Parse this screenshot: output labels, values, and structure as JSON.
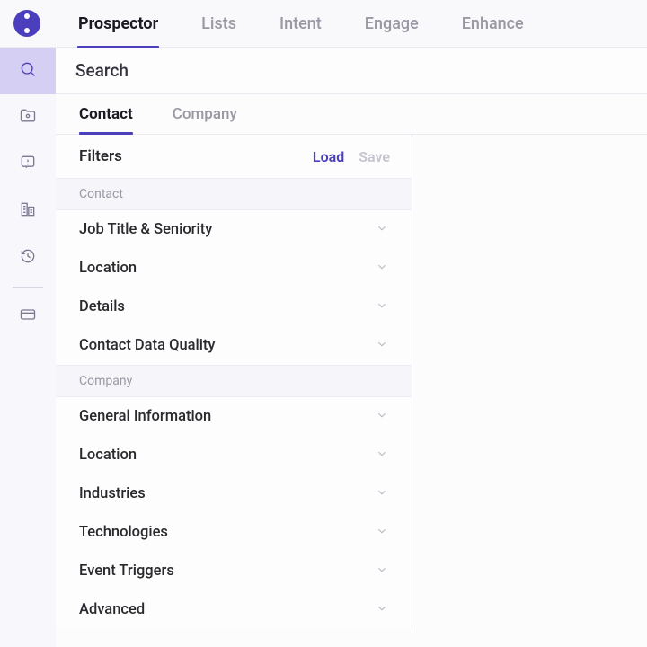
{
  "topnav": {
    "items": [
      "Prospector",
      "Lists",
      "Intent",
      "Engage",
      "Enhance"
    ],
    "activeIndex": 0
  },
  "search": {
    "placeholder": "Search"
  },
  "subtabs": {
    "items": [
      "Contact",
      "Company"
    ],
    "activeIndex": 0
  },
  "filters": {
    "title": "Filters",
    "actions": {
      "load": "Load",
      "save": "Save"
    },
    "sections": [
      {
        "label": "Contact",
        "items": [
          "Job Title & Seniority",
          "Location",
          "Details",
          "Contact Data Quality"
        ]
      },
      {
        "label": "Company",
        "items": [
          "General Information",
          "Location",
          "Industries",
          "Technologies",
          "Event Triggers",
          "Advanced"
        ]
      }
    ]
  }
}
